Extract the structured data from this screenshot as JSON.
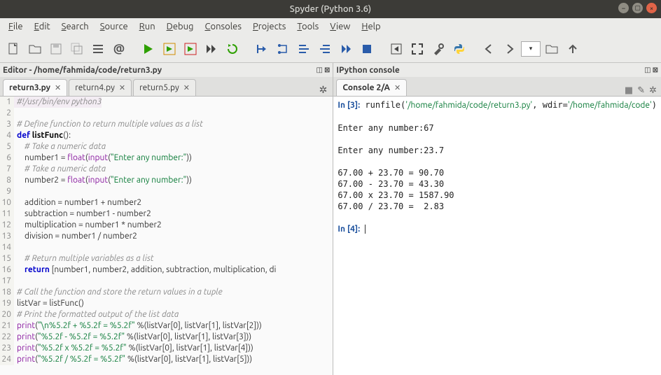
{
  "window": {
    "title": "Spyder (Python 3.6)"
  },
  "menu": [
    "File",
    "Edit",
    "Search",
    "Source",
    "Run",
    "Debug",
    "Consoles",
    "Projects",
    "Tools",
    "View",
    "Help"
  ],
  "editor_title": "Editor - /home/fahmida/code/return3.py",
  "editor_tabs": [
    {
      "label": "return3.py",
      "active": true
    },
    {
      "label": "return4.py",
      "active": false
    },
    {
      "label": "return5.py",
      "active": false
    }
  ],
  "code_lines": [
    {
      "n": 1,
      "hl": true,
      "html": "<span class=\"cm\">#!/usr/bin/env python3</span>"
    },
    {
      "n": 2,
      "html": ""
    },
    {
      "n": 3,
      "html": "<span class=\"cm\"># Define function to return multiple values as a list</span>"
    },
    {
      "n": 4,
      "html": "<span class=\"kw\">def</span> <span class=\"fn\">listFunc</span>():"
    },
    {
      "n": 5,
      "html": "    <span class=\"cm\"># Take a numeric data</span>"
    },
    {
      "n": 6,
      "html": "    number1 = <span class=\"bi\">float</span>(<span class=\"bi\">input</span>(<span class=\"st\">\"Enter any number:\"</span>))"
    },
    {
      "n": 7,
      "html": "    <span class=\"cm\"># Take a numeric data</span>"
    },
    {
      "n": 8,
      "html": "    number2 = <span class=\"bi\">float</span>(<span class=\"bi\">input</span>(<span class=\"st\">\"Enter any number:\"</span>))"
    },
    {
      "n": 9,
      "html": ""
    },
    {
      "n": 10,
      "html": "    addition = number1 + number2"
    },
    {
      "n": 11,
      "html": "    subtraction = number1 - number2"
    },
    {
      "n": 12,
      "html": "    multiplication = number1 * number2"
    },
    {
      "n": 13,
      "html": "    division = number1 / number2"
    },
    {
      "n": 14,
      "html": ""
    },
    {
      "n": 15,
      "html": "    <span class=\"cm\"># Return multiple variables as a list</span>"
    },
    {
      "n": 16,
      "html": "    <span class=\"kw\">return</span> [number1, number2, addition, subtraction, multiplication, di"
    },
    {
      "n": 17,
      "html": ""
    },
    {
      "n": 18,
      "html": "<span class=\"cm\"># Call the function and store the return values in a tuple</span>"
    },
    {
      "n": 19,
      "html": "listVar = listFunc()"
    },
    {
      "n": 20,
      "html": "<span class=\"cm\"># Print the formatted output of the list data</span>"
    },
    {
      "n": 21,
      "html": "<span class=\"bi\">print</span>(<span class=\"st\">\"\\n%5.2f + %5.2f = %5.2f\"</span> %(listVar[0], listVar[1], listVar[2]))"
    },
    {
      "n": 22,
      "html": "<span class=\"bi\">print</span>(<span class=\"st\">\"%5.2f - %5.2f = %5.2f\"</span> %(listVar[0], listVar[1], listVar[3]))"
    },
    {
      "n": 23,
      "html": "<span class=\"bi\">print</span>(<span class=\"st\">\"%5.2f x %5.2f = %5.2f\"</span> %(listVar[0], listVar[1], listVar[4]))"
    },
    {
      "n": 24,
      "html": "<span class=\"bi\">print</span>(<span class=\"st\">\"%5.2f / %5.2f = %5.2f\"</span> %(listVar[0], listVar[1], listVar[5]))"
    }
  ],
  "console_title": "IPython console",
  "console_tab": "Console 2/A",
  "console": {
    "in_prompt": "In [3]:",
    "run_call": "runfile(",
    "arg1": "'/home/fahmida/code/return3.py'",
    "wdir_label": ", wdir=",
    "arg2": "'/home/fahmida/code'",
    "close": ")",
    "input_lines": [
      "Enter any number:67",
      "Enter any number:23.7"
    ],
    "result_lines": [
      "67.00 + 23.70 = 90.70",
      "67.00 - 23.70 = 43.30",
      "67.00 x 23.70 = 1587.90",
      "67.00 / 23.70 =  2.83"
    ],
    "next_prompt": "In [4]:"
  }
}
